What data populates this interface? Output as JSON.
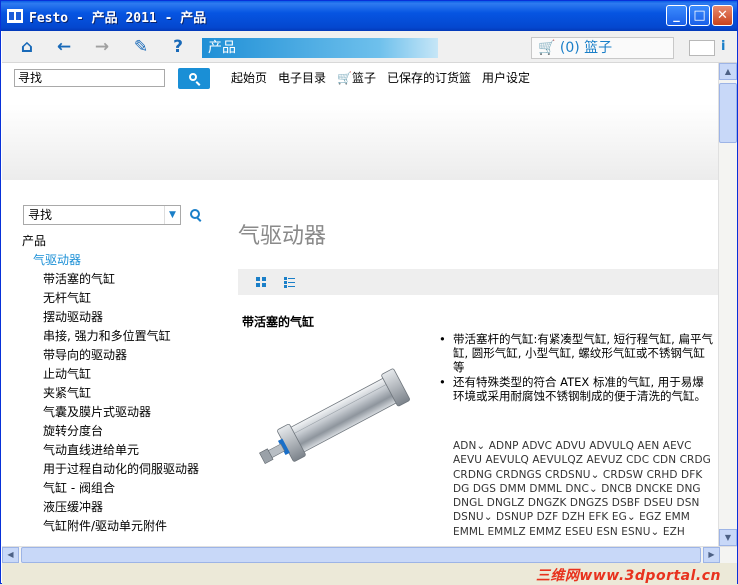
{
  "window": {
    "title": "Festo - 产品 2011 - 产品",
    "minimize": "_",
    "maximize": "□",
    "close": "✕"
  },
  "toolbar": {
    "icons": [
      "home-icon",
      "back-icon",
      "forward-icon",
      "add-to-list-icon",
      "help-icon"
    ],
    "home_glyph": "⌂",
    "back_glyph": "←",
    "forward_glyph": "→",
    "add_glyph": "✎",
    "help_glyph": "?",
    "address": "产品",
    "basket": "🛒 (0) 篮子",
    "info": "i"
  },
  "topnav": {
    "search_value": "寻找",
    "links": [
      "起始页",
      "电子目录",
      "🛒篮子",
      "已保存的订货篮",
      "用户设定"
    ]
  },
  "sidebar": {
    "search_value": "寻找",
    "dropdown_glyph": "▼",
    "tree": [
      {
        "label": "产品",
        "level": 0
      },
      {
        "label": "气驱动器",
        "level": 1
      },
      {
        "label": "带活塞的气缸",
        "level": 2
      },
      {
        "label": "无杆气缸",
        "level": 2
      },
      {
        "label": "摆动驱动器",
        "level": 2
      },
      {
        "label": "串接, 强力和多位置气缸",
        "level": 2
      },
      {
        "label": "带导向的驱动器",
        "level": 2
      },
      {
        "label": "止动气缸",
        "level": 2
      },
      {
        "label": "夹紧气缸",
        "level": 2
      },
      {
        "label": "气囊及膜片式驱动器",
        "level": 2
      },
      {
        "label": "旋转分度台",
        "level": 2
      },
      {
        "label": "气动直线进给单元",
        "level": 2
      },
      {
        "label": "用于过程自动化的伺服驱动器",
        "level": 2
      },
      {
        "label": "气缸 - 阀组合",
        "level": 2
      },
      {
        "label": "液压缓冲器",
        "level": 2
      },
      {
        "label": "气缸附件/驱动单元附件",
        "level": 2
      }
    ]
  },
  "main": {
    "page_title": "气驱动器",
    "section_title": "带活塞的气缸",
    "bullets": [
      "带活塞杆的气缸:有紧凑型气缸, 短行程气缸, 扁平气缸, 圆形气缸, 小型气缸, 螺纹形气缸或不锈钢气缸等",
      "还有特殊类型的符合 ATEX 标准的气缸, 用于易爆环境或采用耐腐蚀不锈钢制成的便于清洗的气缸。"
    ],
    "codes": "ADN⌄ ADNP ADVC ADVU ADVULQ AEN AEVC AEVU AEVULQ AEVULQZ AEVUZ CDC CDN CRDG CRDNG CRDNGS CRDSNU⌄ CRDSW CRHD DFK DG DGS DMM DMML DNC⌄ DNCB DNCKE DNG DNGL DNGLZ DNGZK DNGZS DSBF DSEU DSN DSNU⌄ DSNUP DZF DZH EFK EG⌄ EGZ EMM EMML EMMLZ EMMZ ESEU ESN ESNU⌄ EZH"
  },
  "scrollbars": {
    "up": "▲",
    "down": "▼",
    "left": "◀",
    "right": "▶"
  },
  "watermark": "三维网www.3dportal.cn",
  "colors": {
    "accent": "#1a8fd6",
    "titlebar": "#0655e2",
    "watermark": "#e8321e"
  }
}
